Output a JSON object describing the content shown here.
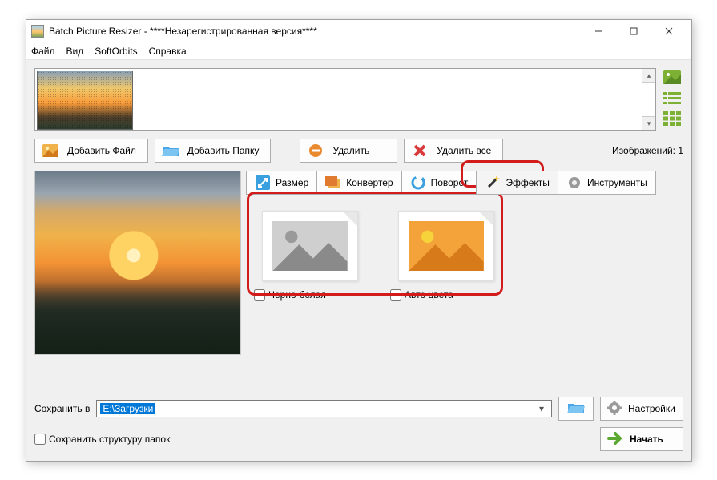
{
  "window": {
    "title": "Batch Picture Resizer - ****Незарегистрированная версия****"
  },
  "menu": {
    "file": "Файл",
    "view": "Вид",
    "softorbits": "SoftOrbits",
    "help": "Справка"
  },
  "toolbar": {
    "add_file": "Добавить Файл",
    "add_folder": "Добавить Папку",
    "delete": "Удалить",
    "delete_all": "Удалить все",
    "images_count_label": "Изображений: 1"
  },
  "tabs": {
    "size": "Размер",
    "convert": "Конвертер",
    "rotate": "Поворот",
    "effects": "Эффекты",
    "tools": "Инструменты"
  },
  "effects": {
    "bw": "Черно-белая",
    "autocolor": "Авто цвета"
  },
  "bottom": {
    "save_in_label": "Сохранить в",
    "save_path": "E:\\Загрузки",
    "keep_structure": "Сохранить структуру папок",
    "settings": "Настройки",
    "start": "Начать"
  }
}
